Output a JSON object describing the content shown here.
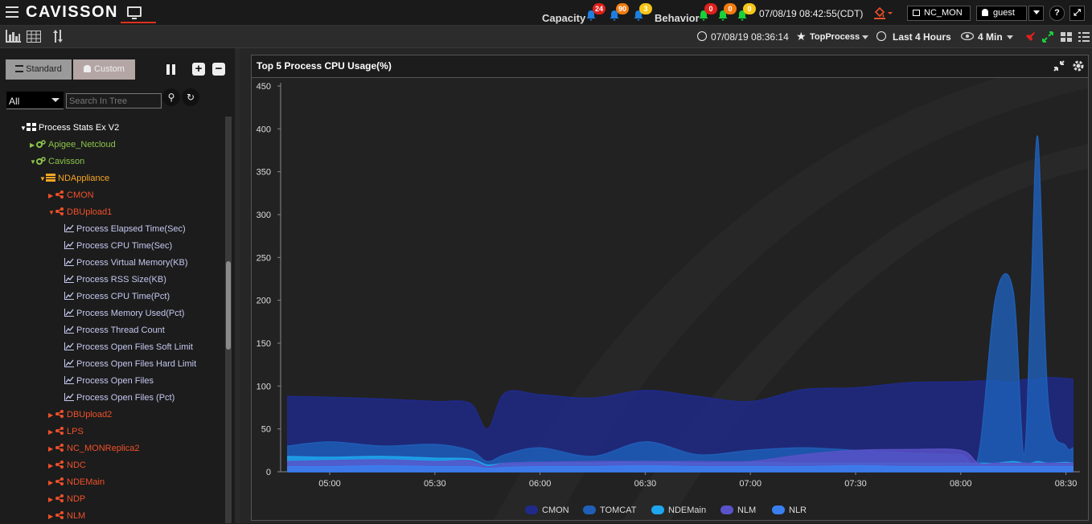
{
  "app": {
    "logo": "CAVISSON",
    "datetime": "07/08/19 08:42:55(CDT)",
    "user_group": "NC_MON",
    "user": "guest",
    "help": "?"
  },
  "alerts": {
    "capacity_label": "Capacity",
    "capacity_counts": [
      "24",
      "90",
      "3"
    ],
    "behavior_label": "Behavior",
    "behavior_counts": [
      "0",
      "0",
      "0"
    ],
    "colors": [
      "#e0201b",
      "#f07c10",
      "#f5c518"
    ]
  },
  "toolbar2": {
    "start_time": "07/08/19 08:36:14",
    "favorite": "TopProcess",
    "range": "Last 4 Hours",
    "interval": "4 Min"
  },
  "sidebar": {
    "tab_standard": "Standard",
    "tab_custom": "Custom",
    "select_value": "All",
    "search_placeholder": "Search In Tree",
    "tree": [
      {
        "label": "Process Stats Ex V2",
        "level": 0,
        "color": "white",
        "arrow": "▼",
        "icon": "grid-icon"
      },
      {
        "label": "Apigee_Netcloud",
        "level": 1,
        "color": "green",
        "arrow": "▶",
        "icon": "cogs-icon"
      },
      {
        "label": "Cavisson",
        "level": 1,
        "color": "green",
        "arrow": "▼",
        "icon": "cogs-icon"
      },
      {
        "label": "NDAppliance",
        "level": 2,
        "color": "orange",
        "arrow": "▼",
        "icon": "server-icon"
      },
      {
        "label": "CMON",
        "level": 3,
        "color": "red",
        "arrow": "▶",
        "icon": "share-icon"
      },
      {
        "label": "DBUpload1",
        "level": 3,
        "color": "red",
        "arrow": "▼",
        "icon": "share-icon"
      },
      {
        "label": "Process Elapsed Time(Sec)",
        "level": 4,
        "color": "lav",
        "arrow": "",
        "icon": "line-chart-icon"
      },
      {
        "label": "Process CPU Time(Sec)",
        "level": 4,
        "color": "lav",
        "arrow": "",
        "icon": "line-chart-icon"
      },
      {
        "label": "Process Virtual Memory(KB)",
        "level": 4,
        "color": "lav",
        "arrow": "",
        "icon": "line-chart-icon"
      },
      {
        "label": "Process RSS Size(KB)",
        "level": 4,
        "color": "lav",
        "arrow": "",
        "icon": "line-chart-icon"
      },
      {
        "label": "Process CPU Time(Pct)",
        "level": 4,
        "color": "lav",
        "arrow": "",
        "icon": "line-chart-icon"
      },
      {
        "label": "Process Memory Used(Pct)",
        "level": 4,
        "color": "lav",
        "arrow": "",
        "icon": "line-chart-icon"
      },
      {
        "label": "Process Thread Count",
        "level": 4,
        "color": "lav",
        "arrow": "",
        "icon": "line-chart-icon"
      },
      {
        "label": "Process Open Files Soft Limit",
        "level": 4,
        "color": "lav",
        "arrow": "",
        "icon": "line-chart-icon"
      },
      {
        "label": "Process Open Files Hard Limit",
        "level": 4,
        "color": "lav",
        "arrow": "",
        "icon": "line-chart-icon"
      },
      {
        "label": "Process Open Files",
        "level": 4,
        "color": "lav",
        "arrow": "",
        "icon": "line-chart-icon"
      },
      {
        "label": "Process Open Files (Pct)",
        "level": 4,
        "color": "lav",
        "arrow": "",
        "icon": "line-chart-icon"
      },
      {
        "label": "DBUpload2",
        "level": 3,
        "color": "red",
        "arrow": "▶",
        "icon": "share-icon"
      },
      {
        "label": "LPS",
        "level": 3,
        "color": "red",
        "arrow": "▶",
        "icon": "share-icon"
      },
      {
        "label": "NC_MONReplica2",
        "level": 3,
        "color": "red",
        "arrow": "▶",
        "icon": "share-icon"
      },
      {
        "label": "NDC",
        "level": 3,
        "color": "red",
        "arrow": "▶",
        "icon": "share-icon"
      },
      {
        "label": "NDEMain",
        "level": 3,
        "color": "red",
        "arrow": "▶",
        "icon": "share-icon"
      },
      {
        "label": "NDP",
        "level": 3,
        "color": "red",
        "arrow": "▶",
        "icon": "share-icon"
      },
      {
        "label": "NLM",
        "level": 3,
        "color": "red",
        "arrow": "▶",
        "icon": "share-icon"
      }
    ]
  },
  "panel": {
    "title": "Top 5 Process CPU Usage(%)"
  },
  "chart_data": {
    "type": "area",
    "title": "Top 5 Process CPU Usage(%)",
    "xlabel": "",
    "ylabel": "",
    "ylim": [
      0,
      450
    ],
    "xlim": [
      "04:46",
      "08:34"
    ],
    "y_ticks": [
      0,
      50,
      100,
      150,
      200,
      250,
      300,
      350,
      400,
      450
    ],
    "x_ticks": [
      "05:00",
      "05:30",
      "06:00",
      "06:30",
      "07:00",
      "07:30",
      "08:00",
      "08:30"
    ],
    "legend_position": "bottom",
    "grid": false,
    "x": [
      "04:48",
      "05:00",
      "05:15",
      "05:30",
      "05:40",
      "05:45",
      "05:50",
      "06:00",
      "06:15",
      "06:30",
      "06:45",
      "07:00",
      "07:15",
      "07:30",
      "07:45",
      "08:00",
      "08:05",
      "08:10",
      "08:15",
      "08:18",
      "08:20",
      "08:22",
      "08:25",
      "08:30",
      "08:32"
    ],
    "series": [
      {
        "name": "CMON",
        "color": "#1f2a8a",
        "values": [
          88,
          87,
          85,
          82,
          80,
          50,
          92,
          90,
          86,
          95,
          88,
          82,
          96,
          98,
          104,
          105,
          106,
          106,
          104,
          108,
          107,
          108,
          110,
          109,
          108
        ]
      },
      {
        "name": "TOMCAT",
        "color": "#1f5fb8",
        "values": [
          30,
          35,
          30,
          32,
          25,
          12,
          20,
          28,
          18,
          35,
          20,
          25,
          28,
          25,
          22,
          20,
          18,
          205,
          210,
          20,
          200,
          390,
          80,
          30,
          28
        ]
      },
      {
        "name": "NDEMain",
        "color": "#1ea7ef",
        "values": [
          18,
          17,
          18,
          16,
          15,
          8,
          10,
          11,
          10,
          12,
          10,
          11,
          10,
          10,
          10,
          10,
          10,
          10,
          12,
          10,
          10,
          12,
          10,
          11,
          10
        ]
      },
      {
        "name": "NLM",
        "color": "#5a52c8",
        "values": [
          12,
          13,
          14,
          12,
          13,
          6,
          10,
          11,
          12,
          12,
          12,
          12,
          20,
          25,
          26,
          25,
          10,
          10,
          10,
          10,
          10,
          10,
          10,
          10,
          10
        ]
      },
      {
        "name": "NLR",
        "color": "#3a7ff0",
        "values": [
          6,
          6,
          7,
          6,
          6,
          4,
          5,
          6,
          6,
          7,
          6,
          6,
          6,
          7,
          6,
          6,
          6,
          6,
          6,
          6,
          6,
          6,
          6,
          6,
          6
        ]
      }
    ]
  }
}
